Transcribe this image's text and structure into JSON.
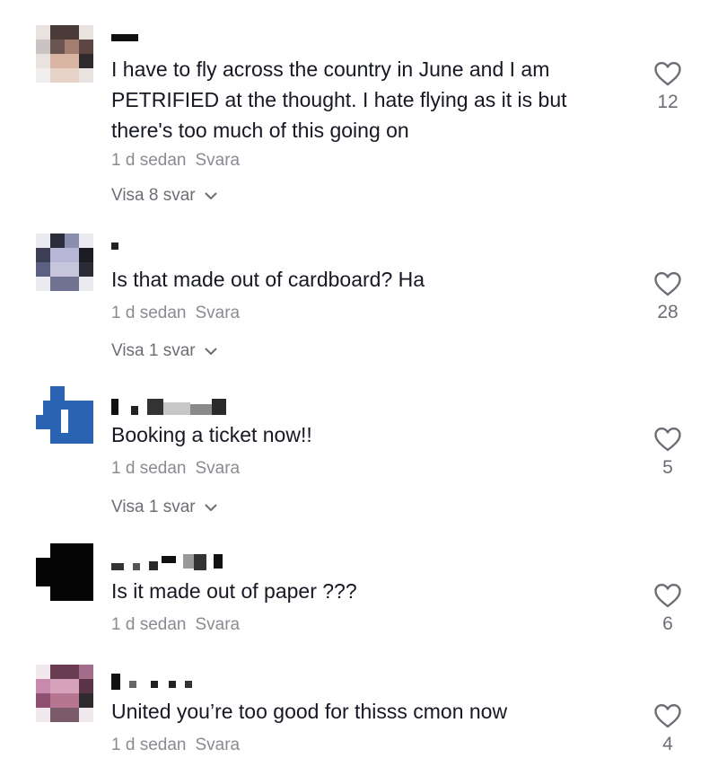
{
  "colors": {
    "text": "#161823",
    "meta": "#8a8b91",
    "muted": "#6d6e75",
    "background": "#ffffff"
  },
  "comments": [
    {
      "text": "I have to fly across the country in June and I am PETRIFIED at the thought. I hate flying as it is but there's too much of this going on",
      "time": "1 d sedan",
      "reply": "Svara",
      "view_replies": "Visa 8 svar",
      "likes": "12"
    },
    {
      "text": "Is that made out of cardboard? Ha",
      "time": "1 d sedan",
      "reply": "Svara",
      "view_replies": "Visa 1 svar",
      "likes": "28"
    },
    {
      "text": "Booking a ticket now!!",
      "time": "1 d sedan",
      "reply": "Svara",
      "view_replies": "Visa 1 svar",
      "likes": "5"
    },
    {
      "text": "Is it made out of paper ???",
      "time": "1 d sedan",
      "reply": "Svara",
      "likes": "6"
    },
    {
      "text": "United you’re too good for thisss cmon now",
      "time": "1 d sedan",
      "reply": "Svara",
      "likes": "4"
    }
  ],
  "icons": {
    "like": "heart-outline-icon",
    "expand": "chevron-down-icon"
  }
}
